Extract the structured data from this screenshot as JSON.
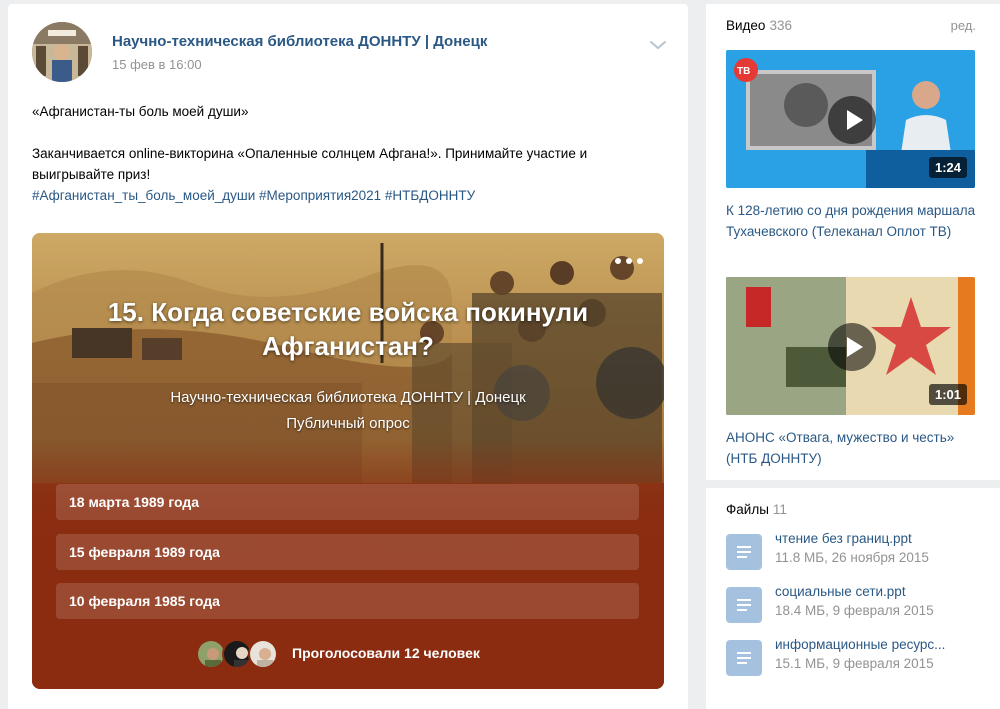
{
  "post": {
    "author": "Научно-техническая библиотека ДОННТУ | Донецк",
    "date": "15 фев в 16:00",
    "title_line": "«Афганистан-ты боль моей души»",
    "body_line": "Заканчивается online-викторина «Опаленные солнцем Афгана!». Принимайте участие и выигрывайте приз!",
    "hashtags": "#Афганистан_ты_боль_моей_души #Мероприятия2021 #НТБДОННТУ"
  },
  "poll": {
    "question": "15. Когда советские войска покинули Афганистан?",
    "author": "Научно-техническая библиотека ДОННТУ | Донецк",
    "type": "Публичный опрос",
    "options": [
      "18 марта 1989 года",
      "15 февраля 1989 года",
      "10 февраля 1985 года"
    ],
    "voters_text": "Проголосовали 12 человек"
  },
  "videos": {
    "title": "Видео",
    "count": "336",
    "edit_label": "ред.",
    "items": [
      {
        "title": "К 128-летию со дня рождения маршала Тухачевского (Телеканал Оплот ТВ)",
        "duration": "1:24"
      },
      {
        "title": "АНОНС «Отвага, мужество и честь» (НТБ ДОННТУ)",
        "duration": "1:01"
      }
    ]
  },
  "files": {
    "title": "Файлы",
    "count": "11",
    "items": [
      {
        "name": "чтение без границ.ppt",
        "meta": "11.8 МБ, 26 ноября 2015"
      },
      {
        "name": "социальные сети.ppt",
        "meta": "18.4 МБ, 9 февраля 2015"
      },
      {
        "name": "информационные ресурс...",
        "meta": "15.1 МБ, 9 февраля 2015"
      }
    ]
  },
  "icons": {
    "chevron": "chevron-down-icon",
    "more": "more-dots-icon",
    "play": "play-icon",
    "document": "document-icon"
  },
  "colors": {
    "link": "#2a5885",
    "muted": "#939393",
    "poll_bottom": "#8b2c10",
    "file_icon": "#a5c1e0"
  }
}
